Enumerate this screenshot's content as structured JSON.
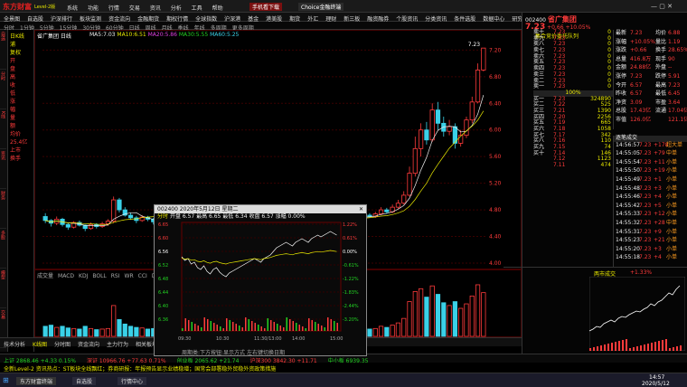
{
  "app": {
    "logo": "东方财富",
    "logo_sub": "Level-2版"
  },
  "menu": [
    "系统",
    "功能",
    "行情",
    "交易",
    "资讯",
    "分析",
    "工具",
    "帮助"
  ],
  "title_buttons": [
    "手机看下载",
    "Choice金融终端"
  ],
  "tabs": [
    "全景图",
    "自选股",
    "沪深排行",
    "板块监测",
    "资金流向",
    "金融期货",
    "期权行情",
    "全球指数",
    "沪深港",
    "基金",
    "港美股",
    "期货",
    "外汇",
    "理财",
    "新三板",
    "融资融券",
    "个股资讯",
    "分类资讯",
    "条件选股",
    "数据中心",
    "研究报告",
    "机构持股",
    "热点题材",
    "股市日历",
    "打开屏幕"
  ],
  "periods": [
    "分时",
    "1分钟",
    "5分钟",
    "15分钟",
    "30分钟",
    "60分钟",
    "日线",
    "周线",
    "月线",
    "季线",
    "年线",
    "多周期",
    "更多周期"
  ],
  "stock": {
    "code": "002400",
    "name": "省广集团",
    "price": "7.23",
    "change": "+0.66",
    "pct": "+10.05%",
    "limit_price": "7.23",
    "auction_label": "集合竞价委托队列"
  },
  "left_info": [
    "日K线",
    "浦",
    "复权",
    "开",
    "盘",
    "高",
    "收",
    "低",
    "涨",
    "幅",
    "量",
    "额",
    "均价",
    "25.4亿",
    "上市",
    "换手"
  ],
  "sidebar_tabs": [
    "自选",
    "分时",
    "K线",
    "资讯",
    "财务",
    "多股",
    "模型",
    "交易"
  ],
  "chart": {
    "header": "省广集团 日线",
    "ma": [
      "MA5:7.03",
      "MA10:6.51",
      "MA20:5.86",
      "MA30:5.55",
      "MA60:5.25"
    ],
    "y_labels": [
      "7.20",
      "6.80",
      "6.40",
      "6.00",
      "5.60",
      "5.20",
      "4.80",
      "4.40",
      "4.00"
    ],
    "peak_label": "7.23"
  },
  "chart_data": {
    "type": "candlestick",
    "series": [
      {
        "o": 4.7,
        "c": 4.64,
        "h": 4.75,
        "l": 4.6,
        "v": 0.18
      },
      {
        "o": 4.64,
        "c": 4.6,
        "h": 4.66,
        "l": 4.55,
        "v": 0.2
      },
      {
        "o": 4.6,
        "c": 4.66,
        "h": 4.7,
        "l": 4.57,
        "v": 0.16
      },
      {
        "o": 4.66,
        "c": 4.58,
        "h": 4.68,
        "l": 4.55,
        "v": 0.18
      },
      {
        "o": 4.58,
        "c": 4.54,
        "h": 4.6,
        "l": 4.5,
        "v": 0.15
      },
      {
        "o": 4.54,
        "c": 4.61,
        "h": 4.63,
        "l": 4.52,
        "v": 0.14
      },
      {
        "o": 4.61,
        "c": 4.57,
        "h": 4.64,
        "l": 4.55,
        "v": 0.13
      },
      {
        "o": 4.57,
        "c": 4.52,
        "h": 4.58,
        "l": 4.48,
        "v": 0.18
      },
      {
        "o": 4.52,
        "c": 4.58,
        "h": 4.61,
        "l": 4.5,
        "v": 0.14
      },
      {
        "o": 4.58,
        "c": 4.55,
        "h": 4.6,
        "l": 4.52,
        "v": 0.12
      },
      {
        "o": 4.55,
        "c": 4.59,
        "h": 4.62,
        "l": 4.53,
        "v": 0.13
      },
      {
        "o": 4.59,
        "c": 4.63,
        "h": 4.66,
        "l": 4.56,
        "v": 0.14
      },
      {
        "o": 4.63,
        "c": 4.95,
        "h": 5.0,
        "l": 4.6,
        "v": 0.55
      },
      {
        "o": 4.95,
        "c": 4.8,
        "h": 4.98,
        "l": 4.76,
        "v": 0.3
      },
      {
        "o": 4.8,
        "c": 4.72,
        "h": 4.84,
        "l": 4.7,
        "v": 0.22
      },
      {
        "o": 4.72,
        "c": 4.68,
        "h": 4.76,
        "l": 4.65,
        "v": 0.18
      },
      {
        "o": 4.68,
        "c": 4.64,
        "h": 4.71,
        "l": 4.6,
        "v": 0.16
      },
      {
        "o": 4.64,
        "c": 4.69,
        "h": 4.72,
        "l": 4.62,
        "v": 0.15
      },
      {
        "o": 4.69,
        "c": 4.66,
        "h": 4.71,
        "l": 4.63,
        "v": 0.13
      },
      {
        "o": 4.66,
        "c": 4.62,
        "h": 4.68,
        "l": 4.58,
        "v": 0.14
      },
      {
        "o": 4.62,
        "c": 4.66,
        "h": 4.68,
        "l": 4.6,
        "v": 0.12
      },
      {
        "o": 4.66,
        "c": 4.63,
        "h": 4.69,
        "l": 4.61,
        "v": 0.12
      },
      {
        "o": 4.63,
        "c": 4.6,
        "h": 4.65,
        "l": 4.57,
        "v": 0.13
      },
      {
        "o": 4.6,
        "c": 4.64,
        "h": 4.66,
        "l": 4.58,
        "v": 0.12
      },
      {
        "o": 4.64,
        "c": 4.67,
        "h": 4.7,
        "l": 4.61,
        "v": 0.13
      },
      {
        "o": 4.67,
        "c": 4.63,
        "h": 4.69,
        "l": 4.6,
        "v": 0.12
      },
      {
        "o": 4.63,
        "c": 4.59,
        "h": 4.65,
        "l": 4.56,
        "v": 0.13
      },
      {
        "o": 4.59,
        "c": 4.62,
        "h": 4.64,
        "l": 4.56,
        "v": 0.12
      },
      {
        "o": 4.62,
        "c": 4.65,
        "h": 4.68,
        "l": 4.6,
        "v": 0.13
      },
      {
        "o": 4.65,
        "c": 4.61,
        "h": 4.67,
        "l": 4.59,
        "v": 0.12
      },
      {
        "o": 4.61,
        "c": 4.63,
        "h": 4.66,
        "l": 4.58,
        "v": 0.12
      },
      {
        "o": 4.63,
        "c": 4.6,
        "h": 4.65,
        "l": 4.57,
        "v": 0.12
      },
      {
        "o": 4.6,
        "c": 4.62,
        "h": 4.64,
        "l": 4.57,
        "v": 0.12
      },
      {
        "o": 4.62,
        "c": 4.59,
        "h": 4.64,
        "l": 4.56,
        "v": 0.12
      },
      {
        "o": 4.59,
        "c": 4.61,
        "h": 4.63,
        "l": 4.56,
        "v": 0.11
      },
      {
        "o": 4.61,
        "c": 4.58,
        "h": 4.63,
        "l": 4.55,
        "v": 0.12
      },
      {
        "o": 4.58,
        "c": 4.6,
        "h": 4.62,
        "l": 4.55,
        "v": 0.11
      },
      {
        "o": 4.6,
        "c": 4.57,
        "h": 4.62,
        "l": 4.54,
        "v": 0.12
      },
      {
        "o": 4.57,
        "c": 4.59,
        "h": 4.61,
        "l": 4.54,
        "v": 0.11
      },
      {
        "o": 4.59,
        "c": 4.62,
        "h": 4.64,
        "l": 4.57,
        "v": 0.12
      },
      {
        "o": 4.62,
        "c": 4.6,
        "h": 4.64,
        "l": 4.58,
        "v": 0.11
      },
      {
        "o": 4.6,
        "c": 4.63,
        "h": 4.65,
        "l": 4.58,
        "v": 0.12
      },
      {
        "o": 4.63,
        "c": 4.61,
        "h": 4.65,
        "l": 4.59,
        "v": 0.11
      },
      {
        "o": 4.61,
        "c": 4.6,
        "h": 4.63,
        "l": 4.58,
        "v": 0.11
      },
      {
        "o": 4.6,
        "c": 4.63,
        "h": 4.65,
        "l": 4.58,
        "v": 0.12
      },
      {
        "o": 4.63,
        "c": 4.62,
        "h": 4.65,
        "l": 4.6,
        "v": 0.11
      },
      {
        "o": 4.62,
        "c": 4.64,
        "h": 4.66,
        "l": 4.6,
        "v": 0.12
      },
      {
        "o": 4.64,
        "c": 4.62,
        "h": 4.66,
        "l": 4.6,
        "v": 0.11
      },
      {
        "o": 4.62,
        "c": 4.64,
        "h": 4.66,
        "l": 4.6,
        "v": 0.12
      },
      {
        "o": 4.64,
        "c": 4.66,
        "h": 4.68,
        "l": 4.62,
        "v": 0.12
      },
      {
        "o": 4.66,
        "c": 4.7,
        "h": 4.73,
        "l": 4.64,
        "v": 0.14
      },
      {
        "o": 4.7,
        "c": 4.68,
        "h": 4.73,
        "l": 4.66,
        "v": 0.13
      },
      {
        "o": 4.68,
        "c": 4.66,
        "h": 4.7,
        "l": 4.63,
        "v": 0.13
      },
      {
        "o": 4.66,
        "c": 4.69,
        "h": 4.71,
        "l": 4.64,
        "v": 0.13
      },
      {
        "o": 4.69,
        "c": 4.67,
        "h": 4.71,
        "l": 4.65,
        "v": 0.12
      },
      {
        "o": 4.67,
        "c": 4.7,
        "h": 4.72,
        "l": 4.65,
        "v": 0.13
      },
      {
        "o": 4.7,
        "c": 4.72,
        "h": 4.75,
        "l": 4.68,
        "v": 0.14
      },
      {
        "o": 4.72,
        "c": 4.7,
        "h": 4.75,
        "l": 4.68,
        "v": 0.13
      },
      {
        "o": 4.7,
        "c": 4.74,
        "h": 4.77,
        "l": 4.68,
        "v": 0.14
      },
      {
        "o": 4.74,
        "c": 4.8,
        "h": 4.84,
        "l": 4.72,
        "v": 0.18
      },
      {
        "o": 4.8,
        "c": 4.77,
        "h": 4.83,
        "l": 4.74,
        "v": 0.16
      },
      {
        "o": 4.77,
        "c": 4.84,
        "h": 4.88,
        "l": 4.75,
        "v": 0.2
      },
      {
        "o": 4.84,
        "c": 4.9,
        "h": 4.95,
        "l": 4.82,
        "v": 0.24
      },
      {
        "o": 4.9,
        "c": 5.02,
        "h": 5.08,
        "l": 4.88,
        "v": 0.32
      },
      {
        "o": 5.02,
        "c": 5.35,
        "h": 5.45,
        "l": 5.0,
        "v": 0.62
      },
      {
        "o": 5.35,
        "c": 5.72,
        "h": 5.9,
        "l": 5.3,
        "v": 0.8
      },
      {
        "o": 5.72,
        "c": 6.0,
        "h": 6.1,
        "l": 5.6,
        "v": 0.85
      },
      {
        "o": 6.0,
        "c": 5.85,
        "h": 6.12,
        "l": 5.78,
        "v": 0.7
      },
      {
        "o": 5.85,
        "c": 6.3,
        "h": 6.4,
        "l": 5.82,
        "v": 0.9
      },
      {
        "o": 6.3,
        "c": 6.1,
        "h": 6.42,
        "l": 6.0,
        "v": 0.75
      },
      {
        "o": 6.1,
        "c": 5.98,
        "h": 6.2,
        "l": 5.9,
        "v": 0.6
      },
      {
        "o": 5.98,
        "c": 6.05,
        "h": 6.15,
        "l": 5.92,
        "v": 0.55
      },
      {
        "o": 6.05,
        "c": 5.8,
        "h": 6.1,
        "l": 5.72,
        "v": 0.62
      },
      {
        "o": 5.8,
        "c": 5.92,
        "h": 6.0,
        "l": 5.75,
        "v": 0.5
      },
      {
        "o": 5.92,
        "c": 6.15,
        "h": 6.2,
        "l": 5.88,
        "v": 0.58
      },
      {
        "o": 6.15,
        "c": 6.42,
        "h": 6.5,
        "l": 6.1,
        "v": 0.72
      },
      {
        "o": 6.42,
        "c": 6.9,
        "h": 7.0,
        "l": 6.4,
        "v": 0.92
      },
      {
        "o": 6.9,
        "c": 7.23,
        "h": 7.23,
        "l": 6.88,
        "v": 0.78
      }
    ],
    "ylim": [
      4.0,
      7.3
    ]
  },
  "order_book": {
    "ask": [
      [
        "卖十",
        "7.23",
        "0"
      ],
      [
        "卖九",
        "7.23",
        "0"
      ],
      [
        "卖八",
        "7.23",
        "0"
      ],
      [
        "卖七",
        "7.23",
        "0"
      ],
      [
        "卖六",
        "7.23",
        "0"
      ],
      [
        "卖五",
        "7.23",
        "0"
      ],
      [
        "卖四",
        "7.23",
        "0"
      ],
      [
        "卖三",
        "7.23",
        "0"
      ],
      [
        "卖二",
        "7.23",
        "0"
      ],
      [
        "卖一",
        "7.23",
        "0"
      ]
    ],
    "bid": [
      [
        "买一",
        "7.23",
        "324890"
      ],
      [
        "买二",
        "7.22",
        "525"
      ],
      [
        "买三",
        "7.21",
        "1390"
      ],
      [
        "买四",
        "7.20",
        "2256"
      ],
      [
        "买五",
        "7.19",
        "665"
      ],
      [
        "买六",
        "7.18",
        "1058"
      ],
      [
        "买七",
        "7.17",
        "342"
      ],
      [
        "买八",
        "7.16",
        "110"
      ],
      [
        "买九",
        "7.15",
        "74"
      ],
      [
        "买十",
        "7.14",
        "146"
      ],
      [
        "",
        "7.12",
        "1123"
      ],
      [
        "",
        "7.11",
        "474"
      ]
    ],
    "spread": "100%"
  },
  "quote": {
    "rows": [
      [
        "最新",
        "7.23",
        "均价",
        "6.88"
      ],
      [
        "涨幅",
        "+10.05%",
        "量比",
        "1.19"
      ],
      [
        "涨跌",
        "+0.66",
        "换手",
        "28.65%"
      ],
      [
        "总量",
        "416.8万",
        "现手",
        "90"
      ],
      [
        "金额",
        "24.88亿",
        "外盘",
        "--"
      ],
      [
        "涨停",
        "7.23",
        "跌停",
        "5.91"
      ],
      [
        "今开",
        "6.57",
        "最高",
        "7.23"
      ],
      [
        "昨收",
        "6.57",
        "最低",
        "6.45"
      ],
      [
        "净资",
        "3.09",
        "市盈",
        "3.64"
      ],
      [
        "总股",
        "17.43亿",
        "流通",
        "17.04亿"
      ],
      [
        "市值",
        "126.0亿",
        "",
        "121.1亿"
      ]
    ]
  },
  "ticks": {
    "header": "逐笔成交",
    "rows": [
      [
        "14:56:57",
        "7.23",
        "+178",
        "超大单"
      ],
      [
        "14:55:05",
        "7.23",
        "+79",
        "中单"
      ],
      [
        "14:55:54",
        "7.23",
        "+11",
        "小单"
      ],
      [
        "14:55:50",
        "7.23",
        "+19",
        "小单"
      ],
      [
        "14:55:49",
        "7.23",
        "+1",
        "小单"
      ],
      [
        "14:55:48",
        "7.23",
        "+3",
        "小单"
      ],
      [
        "14:55:46",
        "7.23",
        "+4",
        "小单"
      ],
      [
        "14:55:42",
        "7.23",
        "+5",
        "小单"
      ],
      [
        "14:55:33",
        "7.23",
        "+12",
        "小单"
      ],
      [
        "14:55:32",
        "7.23",
        "+28",
        "中单"
      ],
      [
        "14:55:31",
        "7.23",
        "+9",
        "小单"
      ],
      [
        "14:55:23",
        "7.23",
        "+21",
        "小单"
      ],
      [
        "14:55:20",
        "7.23",
        "+3",
        "小单"
      ],
      [
        "14:55:18",
        "7.23",
        "+4",
        "小单"
      ]
    ]
  },
  "popup": {
    "title": "002400 2020年5月12日 星期二",
    "tabs": [
      "分时",
      "分笔",
      "成交明细"
    ],
    "info": "开盘 6.57 最高 6.65 最低 6.34 收盘 6.57 涨幅 0.00%",
    "y_left": [
      "6.65",
      "6.60",
      "6.56",
      "6.52",
      "6.48",
      "6.44",
      "6.40",
      "6.36"
    ],
    "y_right": [
      "1.22%",
      "0.61%",
      "0.00%",
      "-0.61%",
      "-1.22%",
      "-1.83%",
      "-2.44%",
      "-3.20%"
    ],
    "x": [
      "09:30",
      "10:30",
      "11:30/13:00",
      "14:00",
      "15:00"
    ],
    "footer": "周期类:下方按钮:显示方式 左右键切换日期"
  },
  "vol_tabs": [
    "成交量",
    "MACD",
    "KDJ",
    "BOLL",
    "RSI",
    "WR",
    "CCI",
    "DMA",
    "TRIX",
    "BIAS",
    "OBV",
    "更多指标"
  ],
  "bottom_tabs": [
    "技术分析",
    "K线图",
    "分时图",
    "资金流向",
    "主力行为",
    "相关板块",
    "F10资料"
  ],
  "mini": {
    "title": "两市成交",
    "pct": "+1.33%"
  },
  "indexbar": {
    "items": [
      "上证 2868.46 +4.33 0.15%",
      "深证 10966.76 +77.63 0.71%",
      "创业板 2065.62 +21.74",
      "沪深300 3842.30 +11.71",
      "中小板 6939.35"
    ]
  },
  "news": "全新Level-2 资讯热点：ST板块全线飘红；券商研报：年报预告显示业绩稳增；国常会部署稳外贸稳外资政策措施",
  "taskbar": {
    "items": [
      "开始",
      "东方财富终端",
      "自选股",
      "行情中心"
    ],
    "clock": "14:57",
    "date": "2020/5/12"
  }
}
